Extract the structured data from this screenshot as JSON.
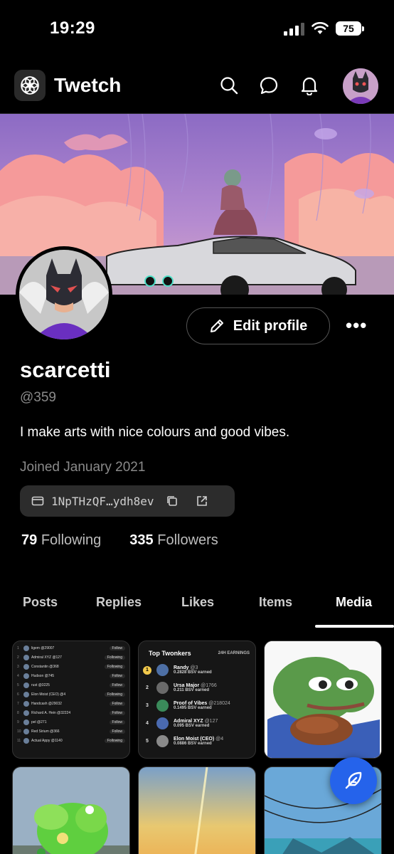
{
  "status_bar": {
    "time": "19:29",
    "battery": "75"
  },
  "header": {
    "app_name": "Twetch",
    "icons": [
      "search-icon",
      "chat-icon",
      "bell-icon"
    ]
  },
  "profile": {
    "edit_label": "Edit profile",
    "more_label": "•••",
    "display_name": "scarcetti",
    "handle": "@359",
    "bio": "I make arts with nice colours and good vibes.",
    "joined": "Joined January 2021",
    "wallet": "1NpTHzQF…ydh8ev",
    "following_count": "79",
    "following_label": "Following",
    "followers_count": "335",
    "followers_label": "Followers"
  },
  "tabs": [
    {
      "label": "Posts",
      "active": false
    },
    {
      "label": "Replies",
      "active": false
    },
    {
      "label": "Likes",
      "active": false
    },
    {
      "label": "Items",
      "active": false
    },
    {
      "label": "Media",
      "active": true
    }
  ],
  "media": {
    "leaderboard": [
      {
        "rank": "1",
        "name": "ligem @29007",
        "action": "Follow"
      },
      {
        "rank": "2",
        "name": "Admiral XYZ @127",
        "action": "Following"
      },
      {
        "rank": "3",
        "name": "Constantin @368",
        "action": "Following"
      },
      {
        "rank": "4",
        "name": "Hudson @745",
        "action": "Follow"
      },
      {
        "rank": "5",
        "name": "rust @3225",
        "action": "Follow"
      },
      {
        "rank": "6",
        "name": "Elon Moist (CEO) @4",
        "action": "Following"
      },
      {
        "rank": "7",
        "name": "Handcash @29032",
        "action": "Follow"
      },
      {
        "rank": "8",
        "name": "Richard A. Hein @32224",
        "action": "Follow"
      },
      {
        "rank": "9",
        "name": "pel @271",
        "action": "Follow"
      },
      {
        "rank": "10",
        "name": "Red Sirium @366",
        "action": "Follow"
      },
      {
        "rank": "11",
        "name": "Actual Appy @1140",
        "action": "Following"
      }
    ],
    "twonkers": {
      "title": "Top Twonkers",
      "subtitle": "24H EARNINGS",
      "rows": [
        {
          "rank": "1",
          "name": "Randy",
          "handle": "@3",
          "earned": "0.2828 BSV earned"
        },
        {
          "rank": "2",
          "name": "Ursa Major",
          "handle": "@1766",
          "earned": "0.211 BSV earned"
        },
        {
          "rank": "3",
          "name": "Proof of Vibes",
          "handle": "@218024",
          "earned": "0.1495 BSV earned"
        },
        {
          "rank": "4",
          "name": "Admiral XYZ",
          "handle": "@127",
          "earned": "0.095 BSV earned"
        },
        {
          "rank": "5",
          "name": "Elon Moist (CEO)",
          "handle": "@4",
          "earned": "0.0886 BSV earned"
        }
      ]
    }
  },
  "colors": {
    "accent": "#2563eb",
    "gold": "#f2c94c",
    "muted": "#8a8a8a"
  }
}
